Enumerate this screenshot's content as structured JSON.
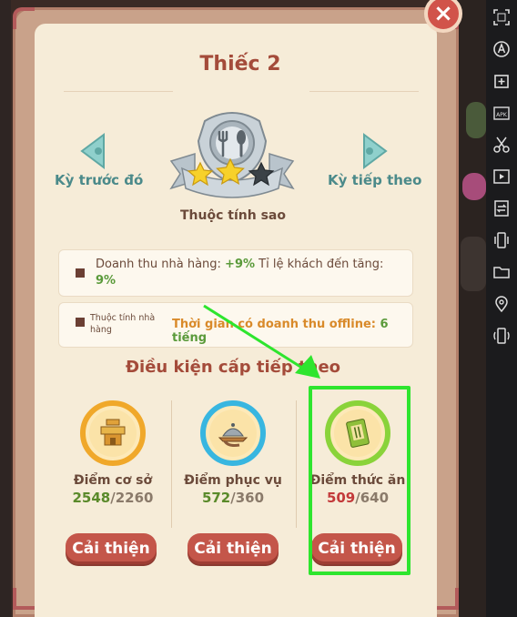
{
  "dialog": {
    "title": "Thiếc 2",
    "close_label": "×",
    "prev_label": "Kỳ trước đó",
    "next_label": "Kỳ tiếp theo",
    "stars_filled": 2,
    "stars_total": 3,
    "attributes_title": "Thuộc tính sao",
    "attr1": {
      "prefix": "Doanh thu nhà hàng: ",
      "value1": "+9%",
      "middle": " Tỉ lệ khách đến tăng: ",
      "value2": "9%"
    },
    "attr2": {
      "label": "Thuộc tính nhà hàng",
      "prefix": "Thời gian có doanh thu offline: ",
      "value": "6 tiếng"
    },
    "conditions_title": "Điều kiện cấp tiếp theo",
    "stats": [
      {
        "label": "Điểm cơ sở",
        "current": "2548",
        "max": "2260",
        "button": "Cải thiện",
        "icon": "building-icon",
        "ring_color": "#f0a82a"
      },
      {
        "label": "Điểm phục vụ",
        "current": "572",
        "max": "360",
        "button": "Cải thiện",
        "icon": "serving-tray-icon",
        "ring_color": "#38b6e0"
      },
      {
        "label": "Điểm thức ăn",
        "current": "509",
        "max": "640",
        "button": "Cải thiện",
        "icon": "cookbook-icon",
        "ring_color": "#8ad33a"
      }
    ]
  },
  "toolbar": {
    "icons": [
      "screenshot-icon",
      "auto-icon",
      "add-window-icon",
      "apk-icon",
      "scissors-icon",
      "video-icon",
      "transfer-icon",
      "vibrate-icon",
      "folder-icon",
      "location-icon",
      "rotate-icon"
    ]
  },
  "colors": {
    "accent": "#a44b3a",
    "button": "#c4564a",
    "highlight": "#2ee52e"
  }
}
